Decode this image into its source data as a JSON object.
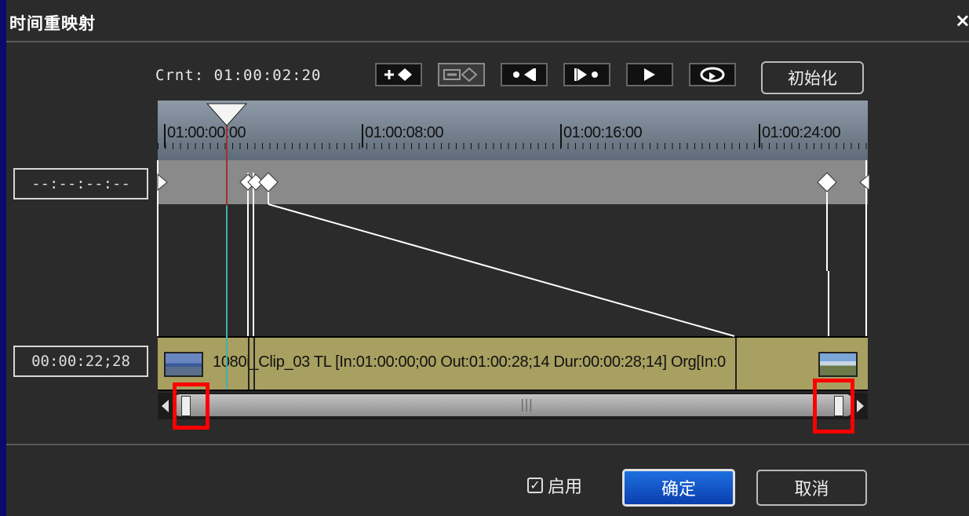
{
  "dialog": {
    "title": "时间重映射",
    "close_label": "×"
  },
  "current_time": "Crnt: 01:00:02:20",
  "toolbar": {
    "buttons": [
      {
        "name": "add-keyframe-button",
        "icon": "add-keyframe-icon"
      },
      {
        "name": "delete-keyframe-button",
        "icon": "remove-keyframe-icon"
      },
      {
        "name": "previous-keyframe-button",
        "icon": "previous-keyframe-icon"
      },
      {
        "name": "next-keyframe-button",
        "icon": "next-keyframe-icon"
      },
      {
        "name": "play-button",
        "icon": "play-icon"
      },
      {
        "name": "loop-button",
        "icon": "loop-icon"
      }
    ],
    "init_label": "初始化"
  },
  "ruler": {
    "labels": [
      "01:00:00:00",
      "01:00:08:00",
      "01:00:16:00",
      "01:00:24:00"
    ]
  },
  "left_panel": {
    "keyframe_time": "--:--:--:--",
    "clip_duration": "00:00:22;28"
  },
  "clip": {
    "label": "1080i_Clip_03  TL [In:01:00:00;00 Out:01:00:28;14 Dur:00:00:28;14] Org[In:0"
  },
  "scrollbar": {
    "grip": "|||"
  },
  "footer": {
    "enable_label": "启用",
    "enable_checked": true,
    "ok_label": "确定",
    "cancel_label": "取消"
  },
  "colors": {
    "accent_red": "#ff0000",
    "ok_blue": "#0a3fae",
    "clip_khaki": "#a8a060",
    "background_navy": "#0a0a6e"
  }
}
